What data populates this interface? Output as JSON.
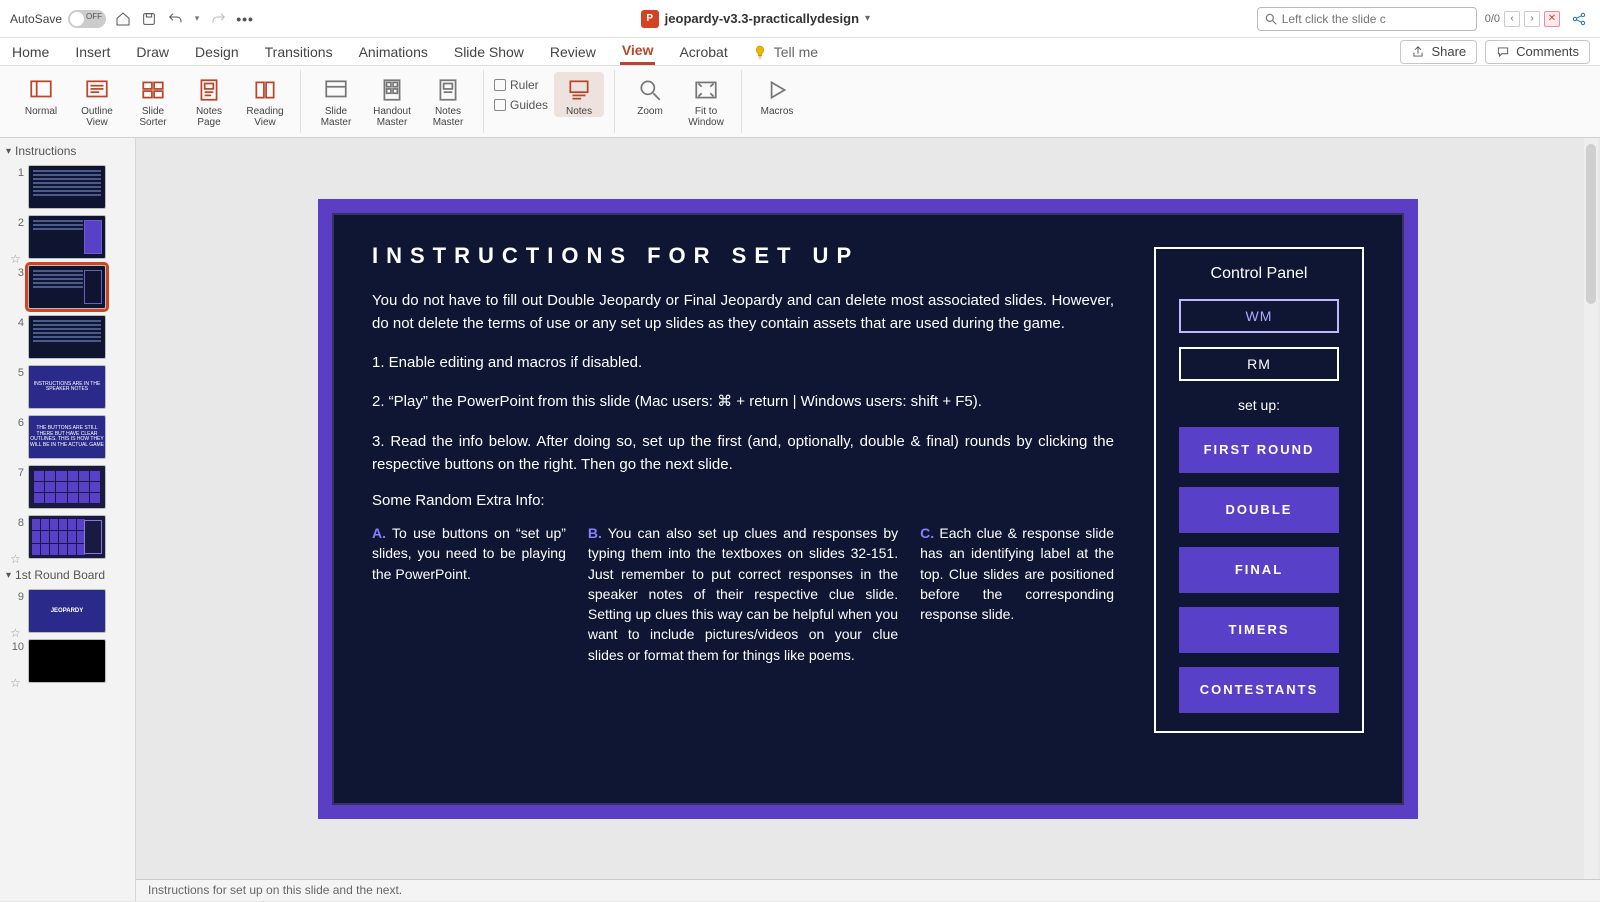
{
  "titlebar": {
    "autosave_label": "AutoSave",
    "autosave_state": "OFF",
    "document_name": "jeopardy-v3.3-practicallydesign",
    "search_placeholder": "Left click the slide c",
    "search_result": "0/0"
  },
  "tabs": {
    "home": "Home",
    "insert": "Insert",
    "draw": "Draw",
    "design": "Design",
    "transitions": "Transitions",
    "animations": "Animations",
    "slide_show": "Slide Show",
    "review": "Review",
    "view": "View",
    "acrobat": "Acrobat",
    "tell_me": "Tell me",
    "share": "Share",
    "comments": "Comments"
  },
  "ribbon": {
    "normal": "Normal",
    "outline_view": "Outline\nView",
    "slide_sorter": "Slide\nSorter",
    "notes_page": "Notes\nPage",
    "reading_view": "Reading\nView",
    "slide_master": "Slide\nMaster",
    "handout_master": "Handout\nMaster",
    "notes_master": "Notes\nMaster",
    "ruler": "Ruler",
    "guides": "Guides",
    "notes": "Notes",
    "zoom": "Zoom",
    "fit_to_window": "Fit to\nWindow",
    "macros": "Macros"
  },
  "sections": {
    "instructions": "Instructions",
    "first_round": "1st Round Board"
  },
  "thumbs": {
    "n1": "1",
    "n2": "2",
    "n3": "3",
    "n4": "4",
    "n5": "5",
    "n6": "6",
    "n7": "7",
    "n8": "8",
    "n9": "9",
    "n10": "10"
  },
  "slide": {
    "title": "INSTRUCTIONS FOR SET UP",
    "p1": "You do not have to fill out Double Jeopardy or Final Jeopardy and can delete most associated slides. However, do not delete the terms of use or any set up slides as they contain assets that are used during the game.",
    "p2": "1. Enable editing and macros if disabled.",
    "p3": "2. “Play” the PowerPoint from this slide (Mac users: ⌘ + return | Windows users: shift + F5).",
    "p4": "3. Read the info below. After doing so, set up the first (and, optionally, double & final) rounds by clicking the respective buttons on the right. Then go the next slide.",
    "extra": "Some Random Extra Info:",
    "colA_hl": "A.",
    "colA": " To use buttons on “set up” slides, you need to be playing the PowerPoint.",
    "colB_hl": "B.",
    "colB": " You can also set up clues and responses by typing them into the textboxes on slides 32-151. Just remember to put correct responses in the speaker notes of their respective clue slide. Setting up clues this way can be helpful when you want to include pictures/videos on your clue slides or format them for things like poems.",
    "colC_hl": "C.",
    "colC": " Each clue & response slide has an identifying label at the top. Clue slides are positioned before the corresponding response slide.",
    "panel": {
      "title": "Control Panel",
      "wm": "WM",
      "rm": "RM",
      "setup": "set up:",
      "first": "FIRST ROUND",
      "double": "DOUBLE",
      "final": "FINAL",
      "timers": "TIMERS",
      "contestants": "CONTESTANTS"
    }
  },
  "thumb_text": {
    "t5": "INSTRUCTIONS ARE IN THE SPEAKER NOTES",
    "t6": "THE BUTTONS ARE STILL THERE BUT HAVE CLEAR OUTLINES. THIS IS HOW THEY WILL BE IN THE ACTUAL GAME",
    "t9": "JEOPARDY"
  },
  "notes": {
    "text": "Instructions for set up on this slide and the next."
  }
}
